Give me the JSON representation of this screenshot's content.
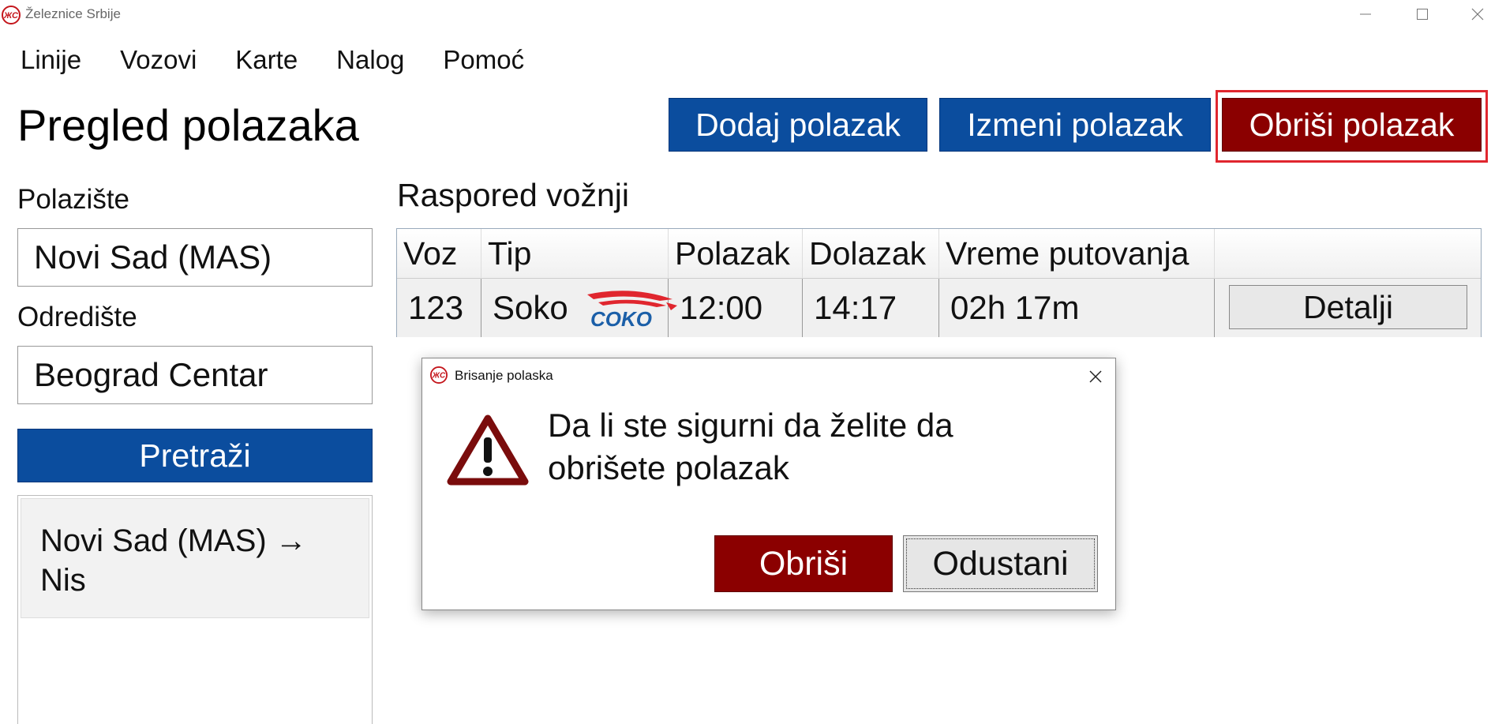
{
  "window": {
    "title": "Železnice Srbije",
    "controls": {
      "minimize": "—",
      "maximize": "☐",
      "close": "✕"
    }
  },
  "menu": [
    "Linije",
    "Vozovi",
    "Karte",
    "Nalog",
    "Pomoć"
  ],
  "page": {
    "title": "Pregled polazaka",
    "buttons": {
      "add": "Dodaj polazak",
      "edit": "Izmeni polazak",
      "delete": "Obriši polazak"
    }
  },
  "search": {
    "from_label": "Polazište",
    "from_value": "Novi Sad (MAS)",
    "to_label": "Odredište",
    "to_value": "Beograd Centar",
    "search_button": "Pretraži",
    "results": [
      "Novi Sad (MAS) → Nis"
    ]
  },
  "schedule": {
    "title": "Raspored vožnji",
    "columns": [
      "Voz",
      "Tip",
      "Polazak",
      "Dolazak",
      "Vreme putovanja",
      ""
    ],
    "rows": [
      {
        "voz": "123",
        "tip": "Soko",
        "polazak": "12:00",
        "dolazak": "14:17",
        "vreme": "02h 17m",
        "details_button": "Detalji"
      }
    ]
  },
  "dialog": {
    "title": "Brisanje polaska",
    "message": "Da li ste sigurni da želite da obrišete polazak",
    "confirm": "Obriši",
    "cancel": "Odustani",
    "icon": "warning-icon"
  },
  "colors": {
    "primary": "#0b4d9e",
    "danger": "#8b0000",
    "highlight": "#e0262e"
  }
}
